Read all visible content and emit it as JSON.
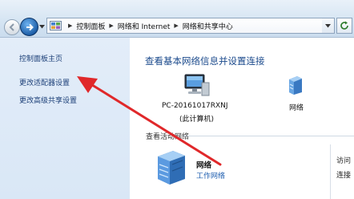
{
  "address_bar": {
    "crumbs": [
      "控制面板",
      "网络和 Internet",
      "网络和共享中心"
    ]
  },
  "left_pane": {
    "items": [
      "控制面板主页",
      "更改适配器设置",
      "更改高级共享设置"
    ]
  },
  "main": {
    "title": "查看基本网络信息并设置连接",
    "computer_name": "PC-20161017RXNJ",
    "computer_note": "(此计算机)",
    "network_node_label": "网络",
    "active_section_title": "查看活动网络",
    "active_network_name": "网络",
    "active_network_type": "工作网络",
    "access_label": "访问",
    "connect_label": "连接"
  },
  "annotation": {
    "arrow_color": "#e0282a"
  },
  "icons": [
    "back-arrow-icon",
    "forward-arrow-icon",
    "control-panel-icon",
    "refresh-icon",
    "computer-icon",
    "network-icon",
    "active-network-icon"
  ]
}
